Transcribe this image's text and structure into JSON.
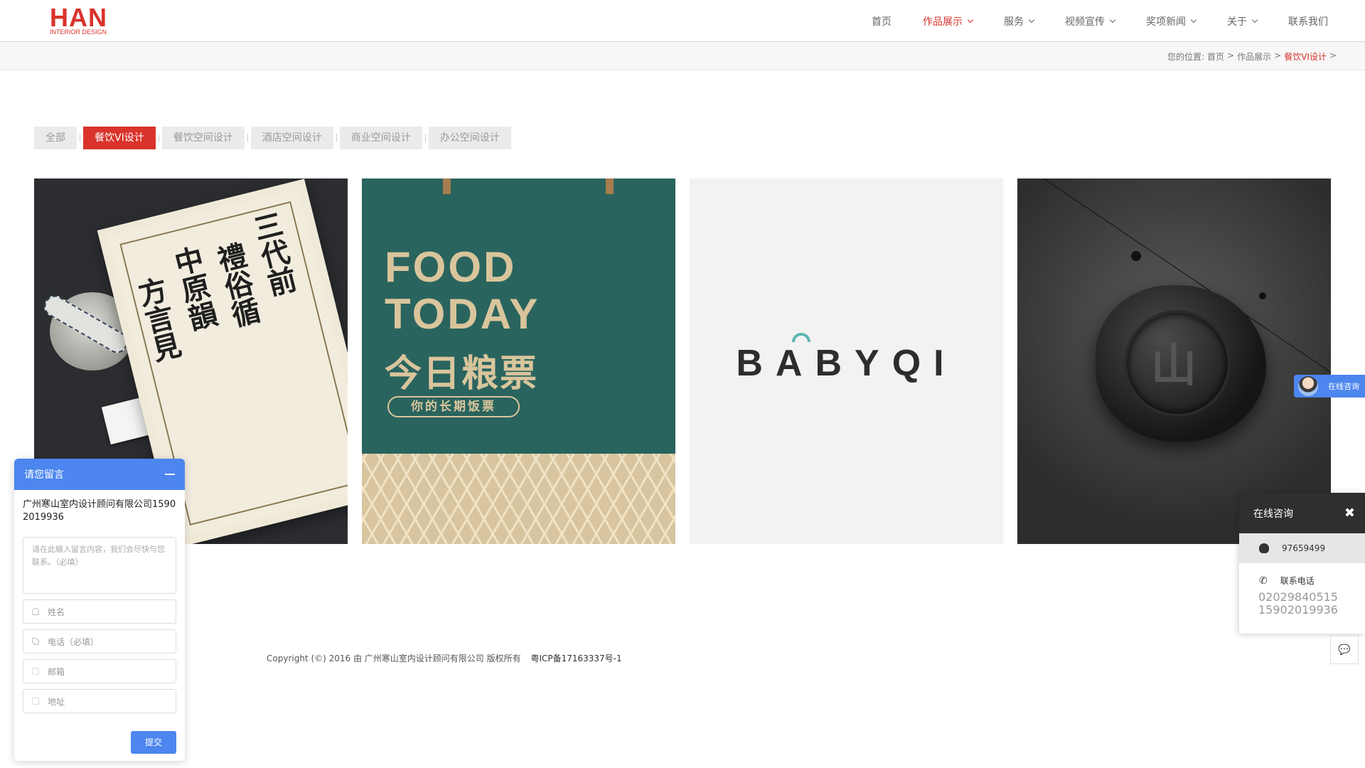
{
  "header": {
    "logo_main": "HAN",
    "logo_sub": "INTERIOR DESIGN",
    "nav": [
      {
        "label": "首页",
        "has_dropdown": false,
        "active": false
      },
      {
        "label": "作品展示",
        "has_dropdown": true,
        "active": true
      },
      {
        "label": "服务",
        "has_dropdown": true,
        "active": false
      },
      {
        "label": "视频宣传",
        "has_dropdown": true,
        "active": false
      },
      {
        "label": "奖项新闻",
        "has_dropdown": true,
        "active": false
      },
      {
        "label": "关于",
        "has_dropdown": true,
        "active": false
      },
      {
        "label": "联系我们",
        "has_dropdown": false,
        "active": false
      }
    ]
  },
  "breadcrumb": {
    "prefix": "您的位置:",
    "items": [
      "首页",
      ">",
      "作品展示",
      ">",
      "餐饮VI设计",
      ">"
    ]
  },
  "filters": [
    "全部",
    "餐饮VI设计",
    "餐饮空间设计",
    "酒店空间设计",
    "商业空间设计",
    "办公空间设计"
  ],
  "active_filter": "餐饮VI设计",
  "gallery": {
    "card1": {
      "calli_a": "三代前",
      "calli_b": "禮俗循",
      "calli_c": "中原韻",
      "calli_d": "方言見"
    },
    "card2": {
      "title1": "FOOD",
      "title2": "TODAY",
      "title_cn": "今日粮票",
      "tag": "你的长期饭票"
    },
    "card3": {
      "brand": "BABYQI"
    },
    "card4": {
      "mark": "山"
    }
  },
  "footer": {
    "copyright": "Copyright (©) 2016 由 广州寒山室内设计顾问有限公司 版权所有",
    "icp": "粤ICP备17163337号-1"
  },
  "message_widget": {
    "title": "请您留言",
    "company": "广州寒山室内设计顾问有限公司15902019936",
    "textarea_placeholder": "请在此输入留言内容，我们会尽快与您联系。（必填）",
    "fields": [
      "姓名",
      "电话（必填）",
      "邮箱",
      "地址"
    ],
    "submit": "提交"
  },
  "float_tab": {
    "label": "在线咨询"
  },
  "online_panel": {
    "title": "在线咨询",
    "qq": "97659499",
    "tel_label": "联系电话",
    "tel1": "02029840515",
    "tel2": "15902019936"
  },
  "colors": {
    "accent": "#d9332b",
    "widget_blue": "#4d86ee",
    "teal": "#2a645e"
  }
}
